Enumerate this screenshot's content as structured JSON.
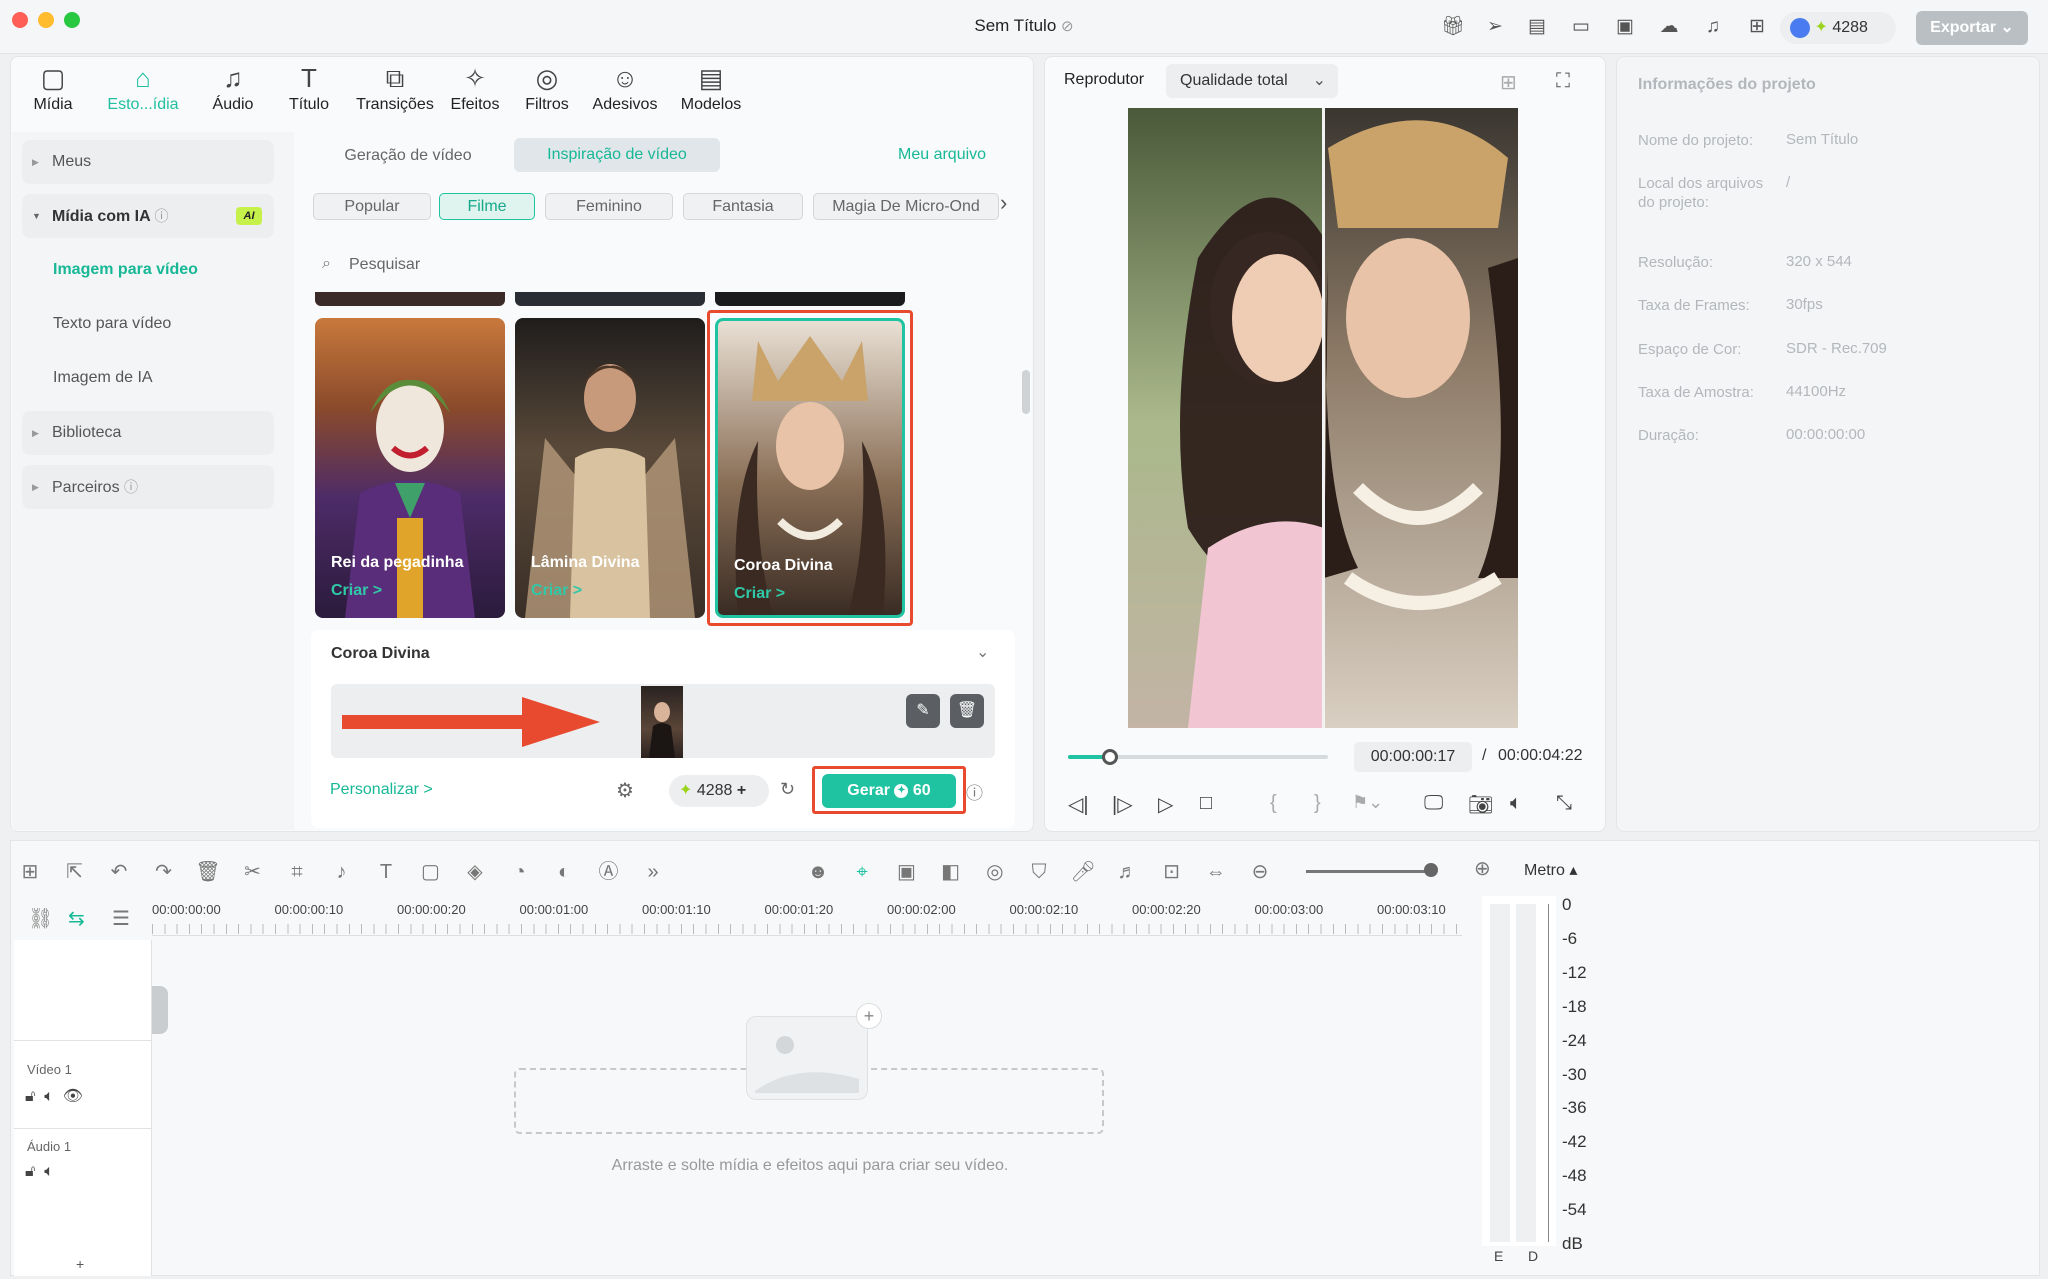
{
  "window": {
    "title": "Sem Título",
    "credits": "4288",
    "export": "Exportar"
  },
  "tabs": [
    {
      "label": "Mídia",
      "icon": "media-icon"
    },
    {
      "label": "Esto...ídia",
      "icon": "store-icon"
    },
    {
      "label": "Áudio",
      "icon": "music-icon"
    },
    {
      "label": "Título",
      "icon": "title-icon"
    },
    {
      "label": "Transições",
      "icon": "transition-icon"
    },
    {
      "label": "Efeitos",
      "icon": "effects-icon"
    },
    {
      "label": "Filtros",
      "icon": "filters-icon"
    },
    {
      "label": "Adesivos",
      "icon": "stickers-icon"
    },
    {
      "label": "Modelos",
      "icon": "templates-icon"
    }
  ],
  "sidebar": {
    "meus": "Meus",
    "midia_ia": "Mídia com IA",
    "ai_badge": "AI",
    "img_video": "Imagem para vídeo",
    "txt_video": "Texto para vídeo",
    "img_ia": "Imagem de IA",
    "biblioteca": "Biblioteca",
    "parceiros": "Parceiros"
  },
  "browser": {
    "subtab1": "Geração de vídeo",
    "subtab2": "Inspiração de vídeo",
    "my_file": "Meu arquivo",
    "search_placeholder": "Pesquisar",
    "chips": [
      "Popular",
      "Filme",
      "Feminino",
      "Fantasia",
      "Magia De Micro-Ond"
    ],
    "cards": [
      {
        "title": "Rei da pegadinha",
        "cta": "Criar >"
      },
      {
        "title": "Lâmina Divina",
        "cta": "Criar >"
      },
      {
        "title": "Coroa Divina",
        "cta": "Criar >"
      }
    ]
  },
  "detail": {
    "title": "Coroa Divina",
    "customize": "Personalizar >",
    "credits": "4288",
    "generate": "Gerar",
    "cost": "60"
  },
  "player": {
    "label": "Reprodutor",
    "quality": "Qualidade total",
    "current": "00:00:00:17",
    "separator": "/",
    "total": "00:00:04:22",
    "progress": 0.16
  },
  "info": {
    "title": "Informações do projeto",
    "rows": [
      {
        "k": "Nome do projeto:",
        "v": "Sem Título"
      },
      {
        "k": "Local dos arquivos do projeto:",
        "v": "/"
      },
      {
        "k": "Resolução:",
        "v": "320 x 544"
      },
      {
        "k": "Taxa de Frames:",
        "v": "30fps"
      },
      {
        "k": "Espaço de Cor:",
        "v": "SDR - Rec.709"
      },
      {
        "k": "Taxa de Amostra:",
        "v": "44100Hz"
      },
      {
        "k": "Duração:",
        "v": "00:00:00:00"
      }
    ]
  },
  "timeline": {
    "metro": "Metro",
    "ruler": [
      "00:00:00:00",
      "00:00:00:10",
      "00:00:00:20",
      "00:00:01:00",
      "00:00:01:10",
      "00:00:01:20",
      "00:00:02:00",
      "00:00:02:10",
      "00:00:02:20",
      "00:00:03:00",
      "00:00:03:10"
    ],
    "video_track": "Vídeo 1",
    "audio_track": "Áudio 1",
    "drop_hint": "Arraste e solte mídia e efeitos aqui para criar seu vídeo.",
    "meter": [
      "0",
      "-6",
      "-12",
      "-18",
      "-24",
      "-30",
      "-36",
      "-42",
      "-48",
      "-54",
      "dB"
    ],
    "meter_e": "E",
    "meter_d": "D"
  },
  "colors": {
    "accent": "#1fc3a1",
    "highlight": "#e84a2f",
    "selected_tab": "#1fbfa0"
  }
}
